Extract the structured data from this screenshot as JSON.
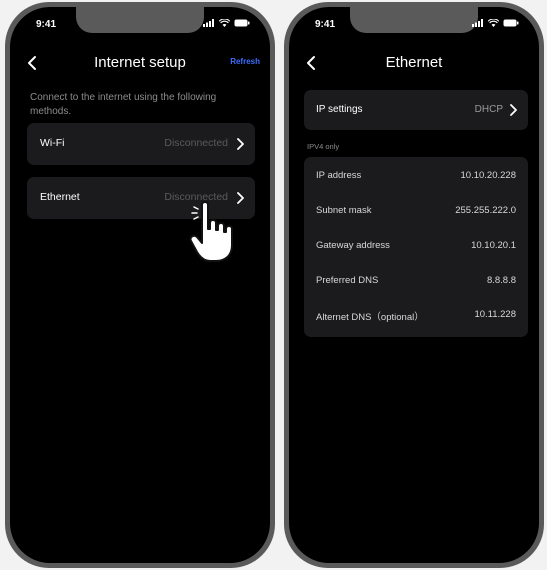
{
  "left_screen": {
    "status": {
      "time": "9:41"
    },
    "nav": {
      "title": "Internet setup",
      "action": "Refresh"
    },
    "description": "Connect to the internet using the following methods.",
    "rows": [
      {
        "label": "Wi-Fi",
        "value": "Disconnected"
      },
      {
        "label": "Ethernet",
        "value": "Disconnected"
      }
    ]
  },
  "right_screen": {
    "status": {
      "time": "9:41"
    },
    "nav": {
      "title": "Ethernet"
    },
    "ip_settings": {
      "label": "IP settings",
      "value": "DHCP"
    },
    "section_label": "IPV4 only",
    "details": [
      {
        "key": "IP address",
        "value": "10.10.20.228"
      },
      {
        "key": "Subnet mask",
        "value": "255.255.222.0"
      },
      {
        "key": "Gateway address",
        "value": "10.10.20.1"
      },
      {
        "key": "Preferred DNS",
        "value": "8.8.8.8"
      },
      {
        "key": "Alternet DNS（optional）",
        "value": "10.11.228"
      }
    ]
  },
  "colors": {
    "accent": "#3b6cff",
    "background": "#000000",
    "card": "#1b1b1d",
    "muted_text": "#8c8c8c"
  },
  "icons": [
    "back-chevron-icon",
    "chevron-right-icon",
    "signal-icon",
    "wifi-icon",
    "battery-icon",
    "tap-hand-icon"
  ]
}
